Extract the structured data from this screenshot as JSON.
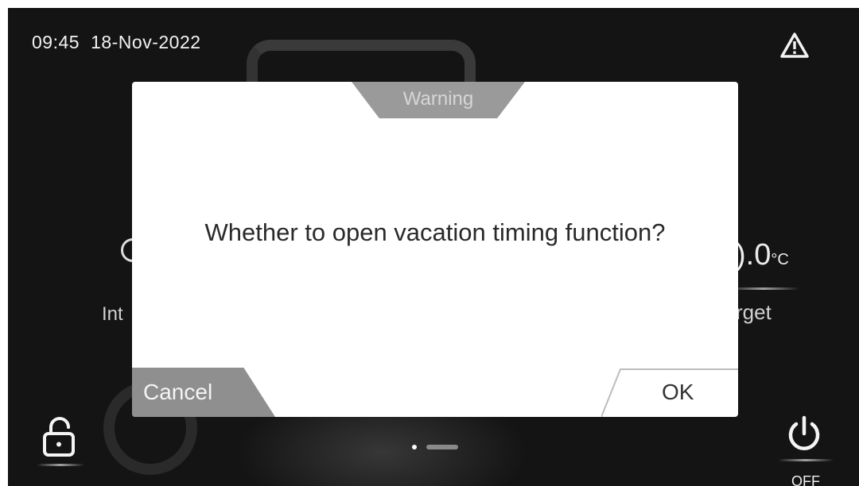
{
  "status_bar": {
    "time": "09:45",
    "date": "18-Nov-2022"
  },
  "background": {
    "left_label": "Int",
    "temperature_value": ").0",
    "temperature_unit": "°C",
    "right_label": "rget",
    "power_state": "OFF"
  },
  "dialog": {
    "title": "Warning",
    "message": "Whether to open vacation timing function?",
    "cancel_label": "Cancel",
    "ok_label": "OK"
  },
  "icons": {
    "warning": "warning-triangle-icon",
    "lock": "unlock-icon",
    "power": "power-icon"
  },
  "colors": {
    "dialog_bg": "#ffffff",
    "title_tab": "#9a9a9a",
    "cancel_button": "#8f8f8f",
    "screen_bg": "#101010"
  }
}
